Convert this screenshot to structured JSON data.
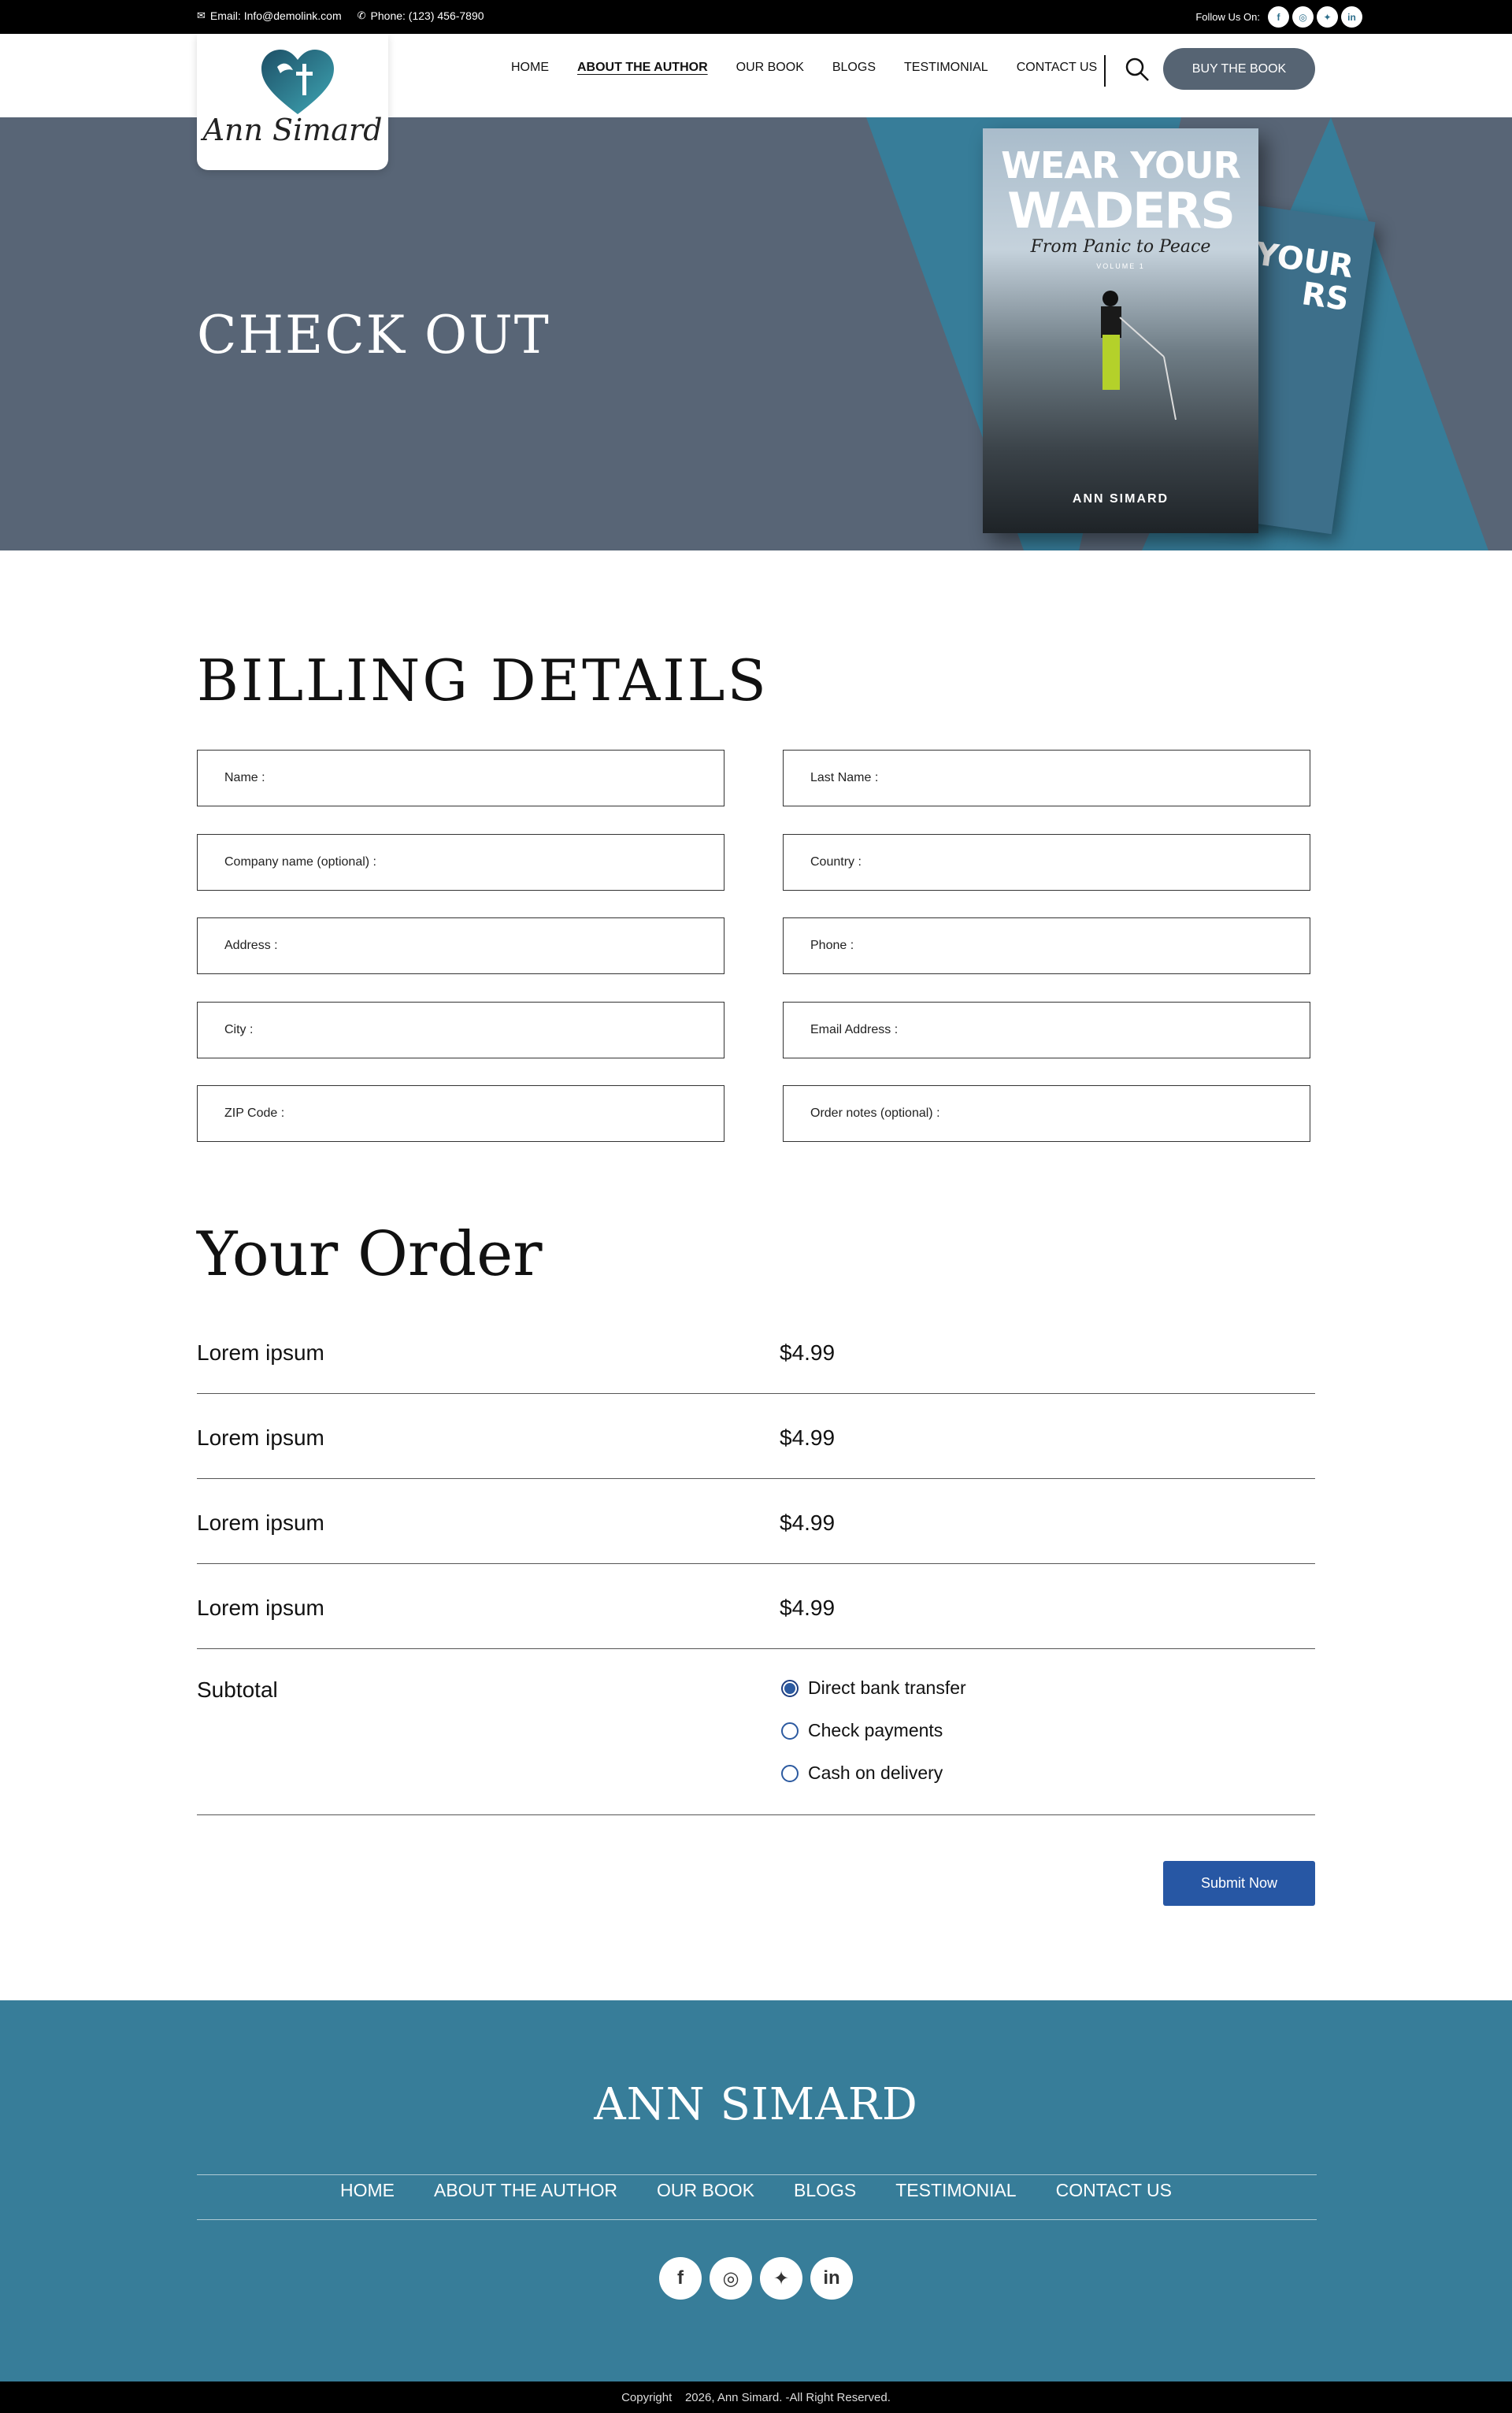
{
  "topbar": {
    "email": "Email: Info@demolink.com",
    "phone": "Phone: (123) 456-7890",
    "follow_label": "Follow Us On:",
    "social": [
      "f",
      "ig",
      "tw",
      "in"
    ]
  },
  "logo": {
    "name": "Ann Simard"
  },
  "nav": {
    "items": [
      "HOME",
      "ABOUT THE AUTHOR",
      "OUR BOOK",
      "BLOGS",
      "TESTIMONIAL",
      "CONTACT US"
    ],
    "active_index": 1,
    "buy_button": "BUY THE BOOK"
  },
  "hero": {
    "title": "CHECK OUT",
    "book": {
      "line1": "WEAR YOUR",
      "line2": "WADERS",
      "subtitle": "From Panic to Peace",
      "volume": "VOLUME 1",
      "author": "ANN SIMARD",
      "back_text": "YOUR\nRS"
    }
  },
  "billing": {
    "title": "BILLING DETAILS",
    "fields_left": [
      "Name :",
      "Company name (optional) :",
      "Address :",
      "City :",
      "ZIP Code :"
    ],
    "fields_right": [
      "Last Name :",
      "Country :",
      "Phone :",
      "Email Address :",
      "Order notes (optional) :"
    ]
  },
  "order": {
    "title": "Your Order",
    "items": [
      {
        "name": "Lorem ipsum",
        "price": "$4.99"
      },
      {
        "name": "Lorem ipsum",
        "price": "$4.99"
      },
      {
        "name": "Lorem ipsum",
        "price": "$4.99"
      },
      {
        "name": "Lorem ipsum",
        "price": "$4.99"
      }
    ],
    "subtotal_label": "Subtotal",
    "payment_options": [
      "Direct bank transfer",
      "Check payments",
      "Cash on delivery"
    ],
    "selected_payment": 0,
    "submit": "Submit Now"
  },
  "footer": {
    "brand": "ANN SIMARD",
    "nav": [
      "HOME",
      "ABOUT THE AUTHOR",
      "OUR BOOK",
      "BLOGS",
      "TESTIMONIAL",
      "CONTACT US"
    ],
    "social": [
      "f",
      "ig",
      "tw",
      "in"
    ],
    "copyright": "Copyright    2026, Ann Simard. -All Right Reserved."
  },
  "colors": {
    "hero_bg": "#586576",
    "accent_teal": "#377d99",
    "button_blue": "#2757a4",
    "buy_button": "#566473"
  }
}
